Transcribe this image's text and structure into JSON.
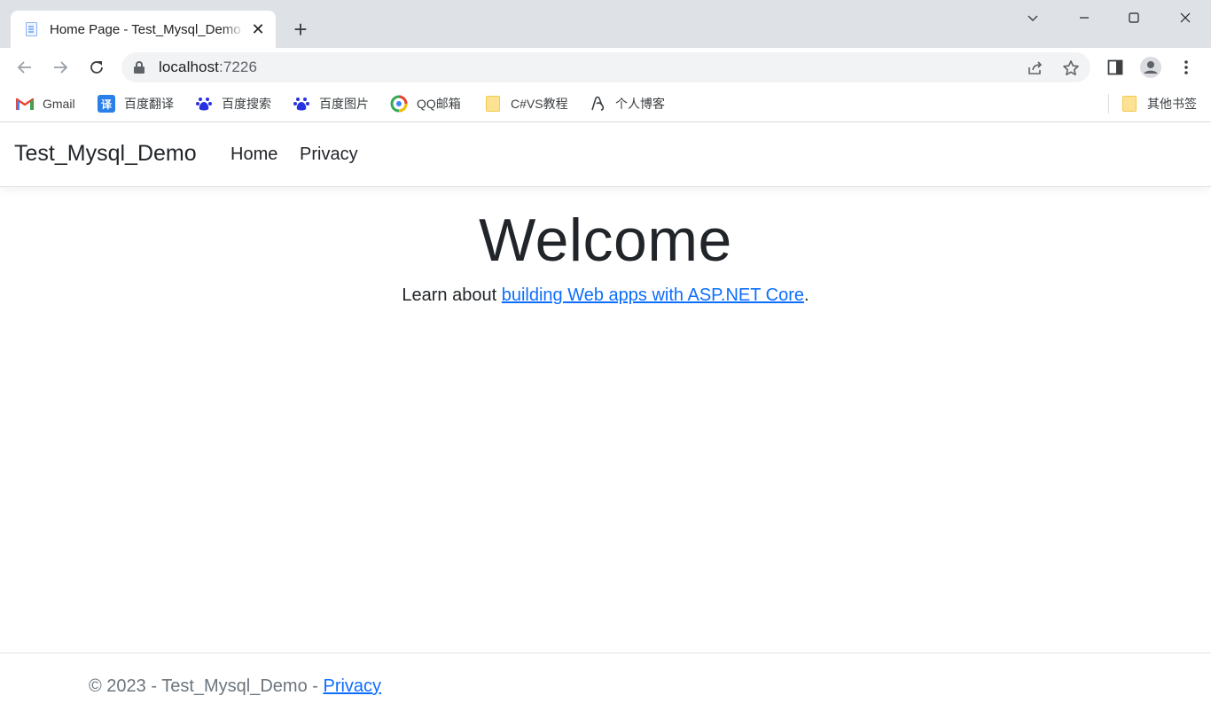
{
  "browser": {
    "tab_title": "Home Page - Test_Mysql_Demo",
    "close_glyph": "✕",
    "new_tab_glyph": "+",
    "url_host": "localhost",
    "url_port": ":7226"
  },
  "bookmarks": [
    {
      "label": "Gmail",
      "icon": "gmail-icon",
      "glyph": "M",
      "color": "#ea4335"
    },
    {
      "label": "百度翻译",
      "icon": "translate-icon",
      "glyph": "译",
      "color": "#2b7fe8"
    },
    {
      "label": "百度搜索",
      "icon": "baidu-paw-icon",
      "glyph": "🐾",
      "color": "#2932e1"
    },
    {
      "label": "百度图片",
      "icon": "baidu-paw-icon",
      "glyph": "🐾",
      "color": "#2932e1"
    },
    {
      "label": "QQ邮箱",
      "icon": "qq-mail-icon",
      "glyph": "◎",
      "color": "#34a853"
    },
    {
      "label": "C#VS教程",
      "icon": "folder-icon",
      "glyph": "",
      "color": "#fde293"
    },
    {
      "label": "个人博客",
      "icon": "blog-icon",
      "glyph": "ᕕ",
      "color": "#3c4043"
    }
  ],
  "other_bookmarks": "其他书签",
  "site": {
    "brand": "Test_Mysql_Demo",
    "nav": {
      "home": "Home",
      "privacy": "Privacy"
    },
    "heading": "Welcome",
    "learn_prefix": "Learn about ",
    "learn_link": "building Web apps with ASP.NET Core",
    "learn_suffix": ".",
    "footer_prefix": "© 2023 - Test_Mysql_Demo - ",
    "footer_link": "Privacy"
  }
}
